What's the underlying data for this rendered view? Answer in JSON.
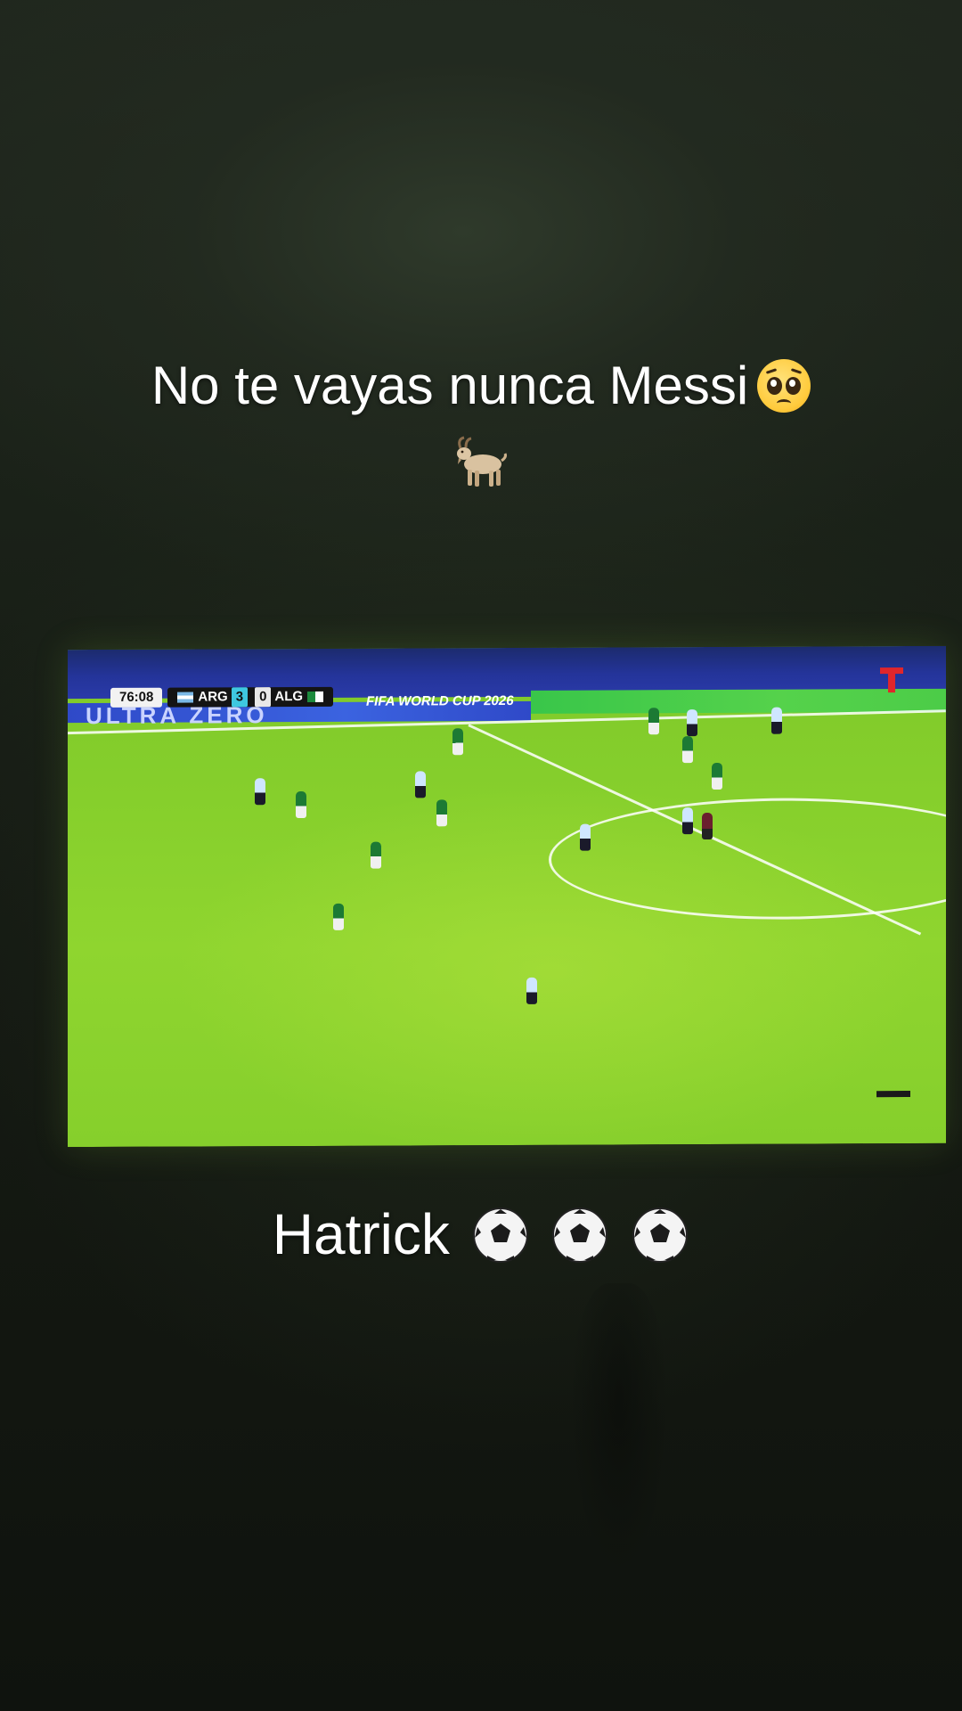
{
  "caption_top": {
    "line1": "No te vayas nunca Messi",
    "line1_emoji": "pleading-face",
    "line2_emoji": "goat"
  },
  "caption_bottom": {
    "text": "Hatrick",
    "emojis": [
      "soccer-ball",
      "soccer-ball",
      "soccer-ball"
    ]
  },
  "tv_broadcast": {
    "clock": "76:08",
    "home_team": "ARG",
    "home_score": "3",
    "away_score": "0",
    "away_team": "ALG",
    "ad_board": "ULTRA ZERO",
    "tournament_banner": "FIFA WORLD CUP 2026"
  },
  "colors": {
    "pitch": "#86cf2c",
    "caption_text": "#ffffff",
    "background": "#141911"
  }
}
